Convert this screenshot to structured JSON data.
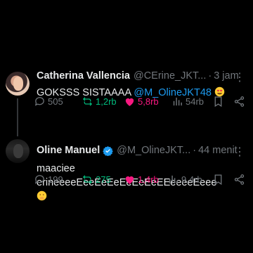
{
  "tweets": [
    {
      "display_name": "Catherina Vallencia",
      "handle": "@CErine_JKT...",
      "separator": "·",
      "time": "3 jam",
      "more": "⋮",
      "text_plain": "GOKSSS SISTAAAA ",
      "mention": "@M_OlineJKT48",
      "emoji": "heart-eyes",
      "stats": {
        "replies": "505",
        "reposts": "1,2rb",
        "likes": "5,8rb",
        "views": "54rb"
      },
      "liked": true,
      "reposted": true
    },
    {
      "display_name": "Oline Manuel",
      "verified": true,
      "handle": "@M_OlineJKT...",
      "separator": "·",
      "time": "44 menit",
      "more": "⋮",
      "text_plain": "maaciee erineeeeEeeEeEeEeEeEeEEeeeeEeee",
      "emoji": "face-with-hand-over-mouth",
      "stats": {
        "replies": "199",
        "reposts": "275",
        "likes": "1,4rb",
        "views": "9,4rb"
      },
      "liked": true,
      "reposted": true
    }
  ],
  "colors": {
    "background": "#000000",
    "accent": "#1d9bf0",
    "retweet": "#00ba7c",
    "like": "#f91880",
    "muted": "#71767b"
  }
}
